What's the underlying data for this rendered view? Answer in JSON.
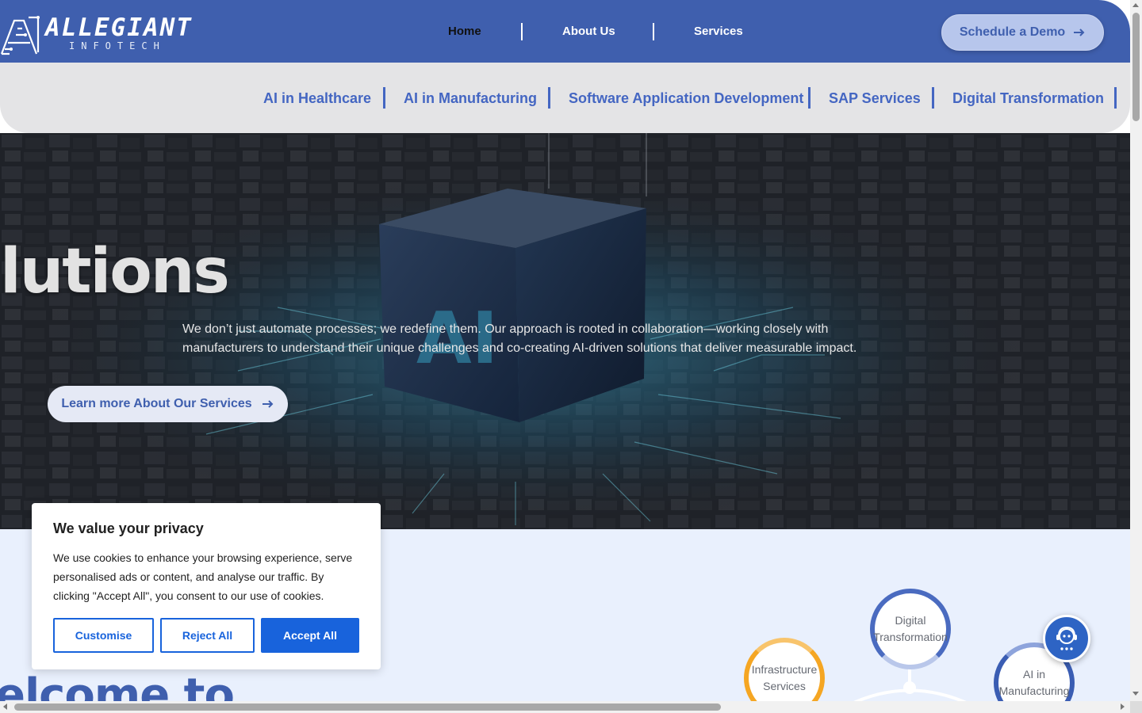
{
  "brand": {
    "name": "ALLEGIANT",
    "tagline": "INFOTECH"
  },
  "nav": {
    "items": [
      {
        "label": "Home",
        "active": true
      },
      {
        "label": "About Us",
        "active": false
      },
      {
        "label": "Services",
        "active": false
      }
    ],
    "cta_label": "Schedule a Demo"
  },
  "services_bar": {
    "items": [
      "AI in Healthcare",
      "AI in Manufacturing",
      "Software Application Development",
      "SAP Services",
      "Digital Transformation"
    ]
  },
  "hero": {
    "title_fragment": "lutions",
    "cube_text": "AI",
    "body": "We don’t just automate processes; we redefine them. Our approach is rooted in collaboration—working closely with manufacturers to understand their unique challenges and co-creating AI-driven solutions that deliver measurable impact.",
    "button_label": "Learn more About Our Services"
  },
  "welcome": {
    "heading_fragment": "elcome to"
  },
  "orbit_nodes": [
    {
      "label": "Digital Transformation",
      "ring_color": "#4a6bc0"
    },
    {
      "label": "Infrastructure Services",
      "ring_color": "#f5a623"
    },
    {
      "label": "AI in Manufacturing",
      "ring_color": "#3a5db3"
    }
  ],
  "cookie": {
    "title": "We value your privacy",
    "body": "We use cookies to enhance your browsing experience, serve personalised ads or content, and analyse our traffic. By clicking \"Accept All\", you consent to our use of cookies.",
    "customise": "Customise",
    "reject": "Reject All",
    "accept": "Accept All"
  },
  "colors": {
    "brand_blue": "#3f5fae",
    "link_blue": "#4466c2",
    "cookie_accent": "#1863dc"
  }
}
